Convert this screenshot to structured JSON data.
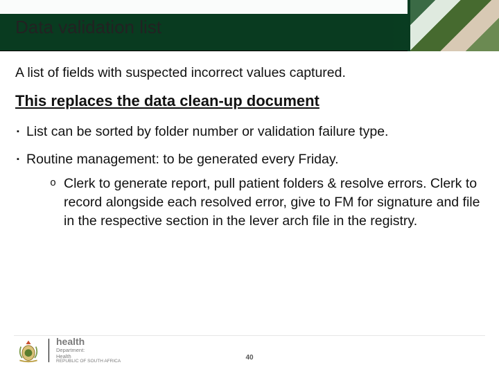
{
  "title": "Data validation list",
  "intro": "A list of fields with suspected incorrect values captured.",
  "replaces": "This replaces the data clean-up document",
  "bullets": [
    {
      "text": "List can be sorted by folder number or validation failure type."
    },
    {
      "text": "Routine management: to be generated every Friday.",
      "sub": [
        "Clerk to generate report, pull patient folders & resolve errors. Clerk to record alongside each resolved error, give to FM for signature and file in the respective section in the lever arch file in the registry."
      ]
    }
  ],
  "footer": {
    "dept_name": "health",
    "dept_sub1": "Department:",
    "dept_sub2": "Health",
    "dept_sub3": "REPUBLIC OF SOUTH AFRICA"
  },
  "page_number": "40"
}
